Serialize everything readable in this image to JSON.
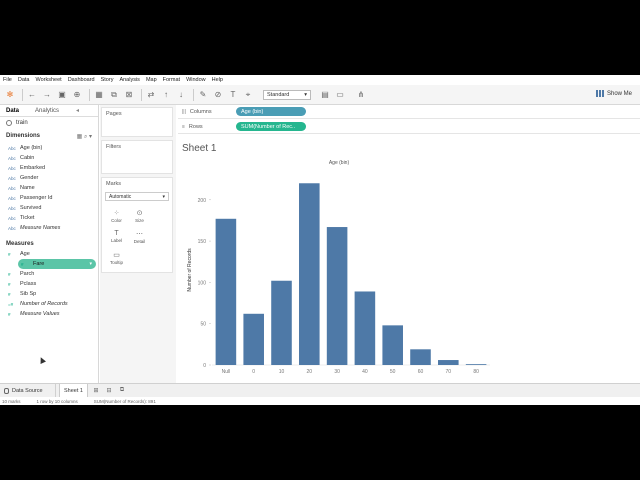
{
  "menu": [
    "File",
    "Data",
    "Worksheet",
    "Dashboard",
    "Story",
    "Analysis",
    "Map",
    "Format",
    "Window",
    "Help"
  ],
  "toolbar": {
    "fit": "Standard",
    "show_me": "Show Me"
  },
  "data_pane": {
    "tab_data": "Data",
    "tab_analytics": "Analytics",
    "datasource": "train",
    "dimensions_label": "Dimensions",
    "dimensions": [
      {
        "type": "Abc",
        "name": "Age (bin)"
      },
      {
        "type": "Abc",
        "name": "Cabin"
      },
      {
        "type": "Abc",
        "name": "Embarked"
      },
      {
        "type": "Abc",
        "name": "Gender"
      },
      {
        "type": "Abc",
        "name": "Name"
      },
      {
        "type": "Abc",
        "name": "Passenger Id"
      },
      {
        "type": "Abc",
        "name": "Survived"
      },
      {
        "type": "Abc",
        "name": "Ticket"
      },
      {
        "type": "Abc",
        "name": "Measure Names"
      }
    ],
    "measures_label": "Measures",
    "measures": [
      {
        "type": "#",
        "name": "Age"
      },
      {
        "type": "#",
        "name": "Fare"
      },
      {
        "type": "#",
        "name": "Parch"
      },
      {
        "type": "#",
        "name": "Pclass"
      },
      {
        "type": "#",
        "name": "Sib Sp"
      },
      {
        "type": "=#",
        "name": "Number of Records"
      },
      {
        "type": "#",
        "name": "Measure Values"
      }
    ]
  },
  "cards": {
    "pages": "Pages",
    "filters": "Filters",
    "marks": "Marks",
    "mark_type": "Automatic",
    "buttons": [
      {
        "glyph": "⁘",
        "label": "Color"
      },
      {
        "glyph": "⊙",
        "label": "Size"
      },
      {
        "glyph": "T",
        "label": "Label"
      },
      {
        "glyph": "⋯",
        "label": "Detail"
      },
      {
        "glyph": "▭",
        "label": "Tooltip"
      }
    ]
  },
  "shelves": {
    "columns_label": "Columns",
    "columns_pill": "Age (bin)",
    "rows_label": "Rows",
    "rows_pill": "SUM(Number of Rec.."
  },
  "sheet_title": "Sheet 1",
  "chart_data": {
    "type": "bar",
    "title": "Age (bin)",
    "ylabel": "Number of Records",
    "categories": [
      "Null",
      "0",
      "10",
      "20",
      "30",
      "40",
      "50",
      "60",
      "70",
      "80"
    ],
    "values": [
      177,
      62,
      102,
      220,
      167,
      89,
      48,
      19,
      6,
      1
    ],
    "ylim": [
      0,
      230
    ],
    "yticks": [
      0,
      50,
      100,
      150,
      200
    ],
    "color": "#4e79a7",
    "grid": false
  },
  "tabs": {
    "datasource": "Data Source",
    "sheet": "Sheet 1"
  },
  "status": {
    "marks": "10 marks",
    "layout": "1 row by 10 columns",
    "sum": "SUM(Number of Records): 891"
  }
}
